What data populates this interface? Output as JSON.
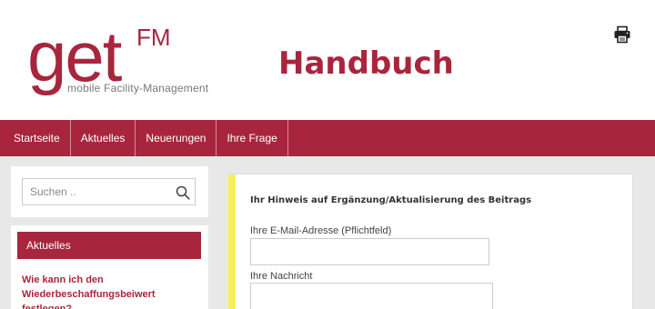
{
  "brand": {
    "logo_main": "get",
    "logo_superscript": "FM",
    "logo_tagline": "mobile Facility-Management",
    "page_title": "Handbuch"
  },
  "toolbar": {
    "print_icon": "printer-icon"
  },
  "nav": {
    "items": [
      {
        "label": "Startseite"
      },
      {
        "label": "Aktuelles"
      },
      {
        "label": "Neuerungen"
      },
      {
        "label": "Ihre Frage"
      }
    ]
  },
  "sidebar": {
    "search": {
      "placeholder": "Suchen ..",
      "icon": "search-icon"
    },
    "news": {
      "header": "Aktuelles",
      "link": "Wie kann ich den Wiederbeschaffungsbeiwert festlegen?"
    }
  },
  "form": {
    "title": "Ihr Hinweis auf Ergänzung/Aktualisierung des Beitrags",
    "email_label": "Ihre E-Mail-Adresse (Pflichtfeld)",
    "email_value": "",
    "message_label": "Ihre Nachricht",
    "message_value": ""
  },
  "colors": {
    "brand": "#a8263d",
    "accent_bar": "#f5f05a",
    "content_background": "#e8e8e8"
  }
}
